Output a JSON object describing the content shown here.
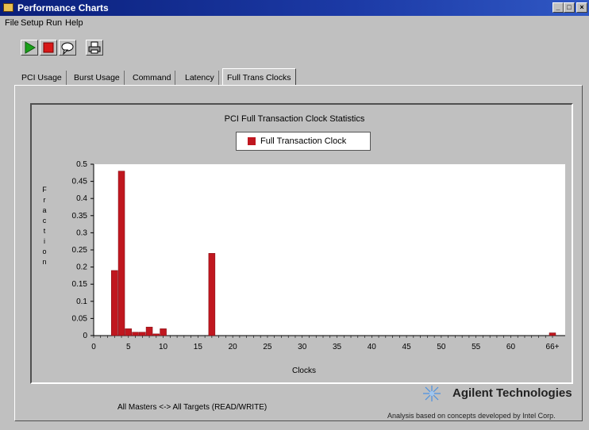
{
  "window": {
    "title": "Performance Charts"
  },
  "menu": [
    "File",
    "Setup",
    "Run",
    "Help"
  ],
  "toolbar": {
    "buttons": [
      {
        "name": "run-button",
        "icon": "play-icon"
      },
      {
        "name": "stop-button",
        "icon": "stop-icon"
      },
      {
        "name": "options-button",
        "icon": "speech-bubble-icon"
      },
      {
        "name": "print-button",
        "icon": "printer-icon"
      }
    ]
  },
  "tabs": [
    {
      "label": "PCI Usage",
      "active": false
    },
    {
      "label": "Burst Usage",
      "active": false
    },
    {
      "label": "Command",
      "active": false
    },
    {
      "label": "Latency",
      "active": false
    },
    {
      "label": "Full Trans Clocks",
      "active": true
    }
  ],
  "chart": {
    "title": "PCI Full Transaction Clock Statistics",
    "legend_label": "Full Transaction Clock"
  },
  "chart_data": {
    "type": "bar",
    "title": "PCI Full Transaction Clock Statistics",
    "xlabel": "Clocks",
    "ylabel": "Fraction",
    "ylim": [
      0,
      0.5
    ],
    "y_ticks": [
      "0",
      "0.05",
      "0.1",
      "0.15",
      "0.2",
      "0.25",
      "0.3",
      "0.35",
      "0.4",
      "0.45",
      "0.5"
    ],
    "x_ticks": [
      "0",
      "5",
      "10",
      "15",
      "20",
      "25",
      "30",
      "35",
      "40",
      "45",
      "50",
      "55",
      "60",
      "66+"
    ],
    "grid": false,
    "legend": "top-center",
    "color": "#c0171f",
    "series": [
      {
        "name": "Full Transaction Clock",
        "points": [
          {
            "x": 3,
            "y": 0.19
          },
          {
            "x": 4,
            "y": 0.48
          },
          {
            "x": 5,
            "y": 0.02
          },
          {
            "x": 6,
            "y": 0.01
          },
          {
            "x": 7,
            "y": 0.01
          },
          {
            "x": 8,
            "y": 0.025
          },
          {
            "x": 9,
            "y": 0.005
          },
          {
            "x": 10,
            "y": 0.02
          },
          {
            "x": 17,
            "y": 0.24
          },
          {
            "x": 66,
            "y": 0.008
          }
        ]
      }
    ]
  },
  "status": {
    "text": "All Masters <-> All Targets  (READ/WRITE)"
  },
  "brand": {
    "name": "Agilent Technologies",
    "note": "Analysis based on concepts developed by Intel Corp."
  }
}
